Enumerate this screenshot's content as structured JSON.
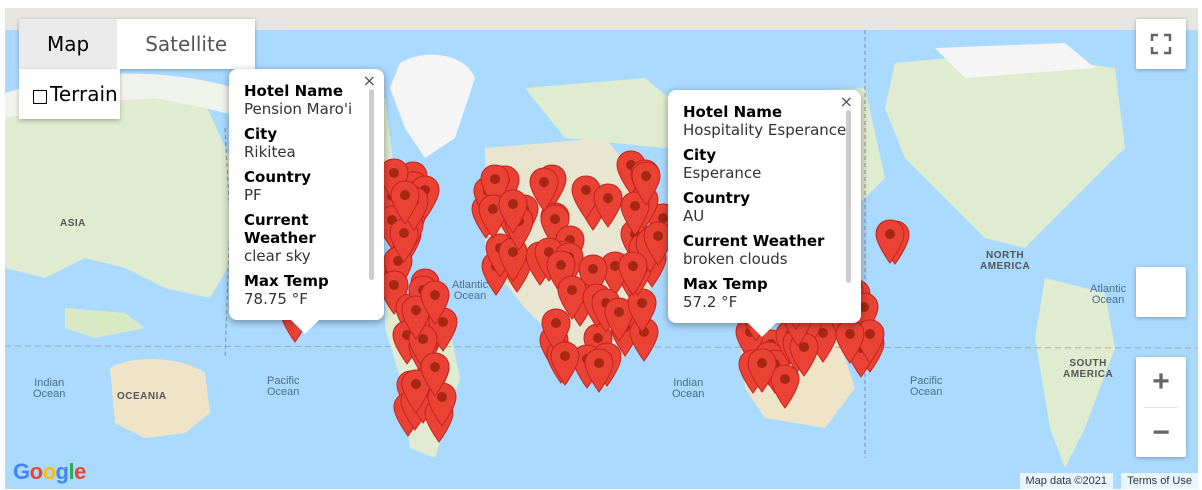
{
  "map_type": {
    "map_label": "Map",
    "satellite_label": "Satellite",
    "terrain_label": "Terrain"
  },
  "labels": {
    "asia_left": "ASIA",
    "oceania": "OCEANIA",
    "north_america": "NORTH\nAMERICA",
    "south_america": "SOUTH\nAMERICA",
    "atlantic_left": "Atlantic\nOcean",
    "atlantic_right": "Atlantic\nOcean",
    "pacific_left": "Pacific\nOcean",
    "pacific_right": "Pacific\nOcean",
    "indian_left": "Indian\nOcean",
    "indian_mid": "Indian\nOcean"
  },
  "popup_left": {
    "hotel_name_label": "Hotel Name",
    "hotel_name": "Pension Maro'i",
    "city_label": "City",
    "city": "Rikitea",
    "country_label": "Country",
    "country": "PF",
    "weather_label": "Current Weather",
    "weather": "clear sky",
    "max_temp_label": "Max Temp",
    "max_temp": "78.75 °F",
    "close": "×"
  },
  "popup_right": {
    "hotel_name_label": "Hotel Name",
    "hotel_name": "Hospitality Esperance",
    "city_label": "City",
    "city": "Esperance",
    "country_label": "Country",
    "country": "AU",
    "weather_label": "Current Weather",
    "weather": "broken clouds",
    "max_temp_label": "Max Temp",
    "max_temp": "57.2 °F",
    "close": "×"
  },
  "footer": {
    "map_data": "Map data ©2021",
    "terms": "Terms of Use"
  },
  "zoom": {
    "in": "+",
    "out": "−"
  },
  "google_logo": "Google",
  "colors": {
    "water": "#aadaff",
    "land": "#dfeccf",
    "ice": "#f5f5f5",
    "marker": "#ea4335",
    "marker_dark": "#a52714"
  }
}
